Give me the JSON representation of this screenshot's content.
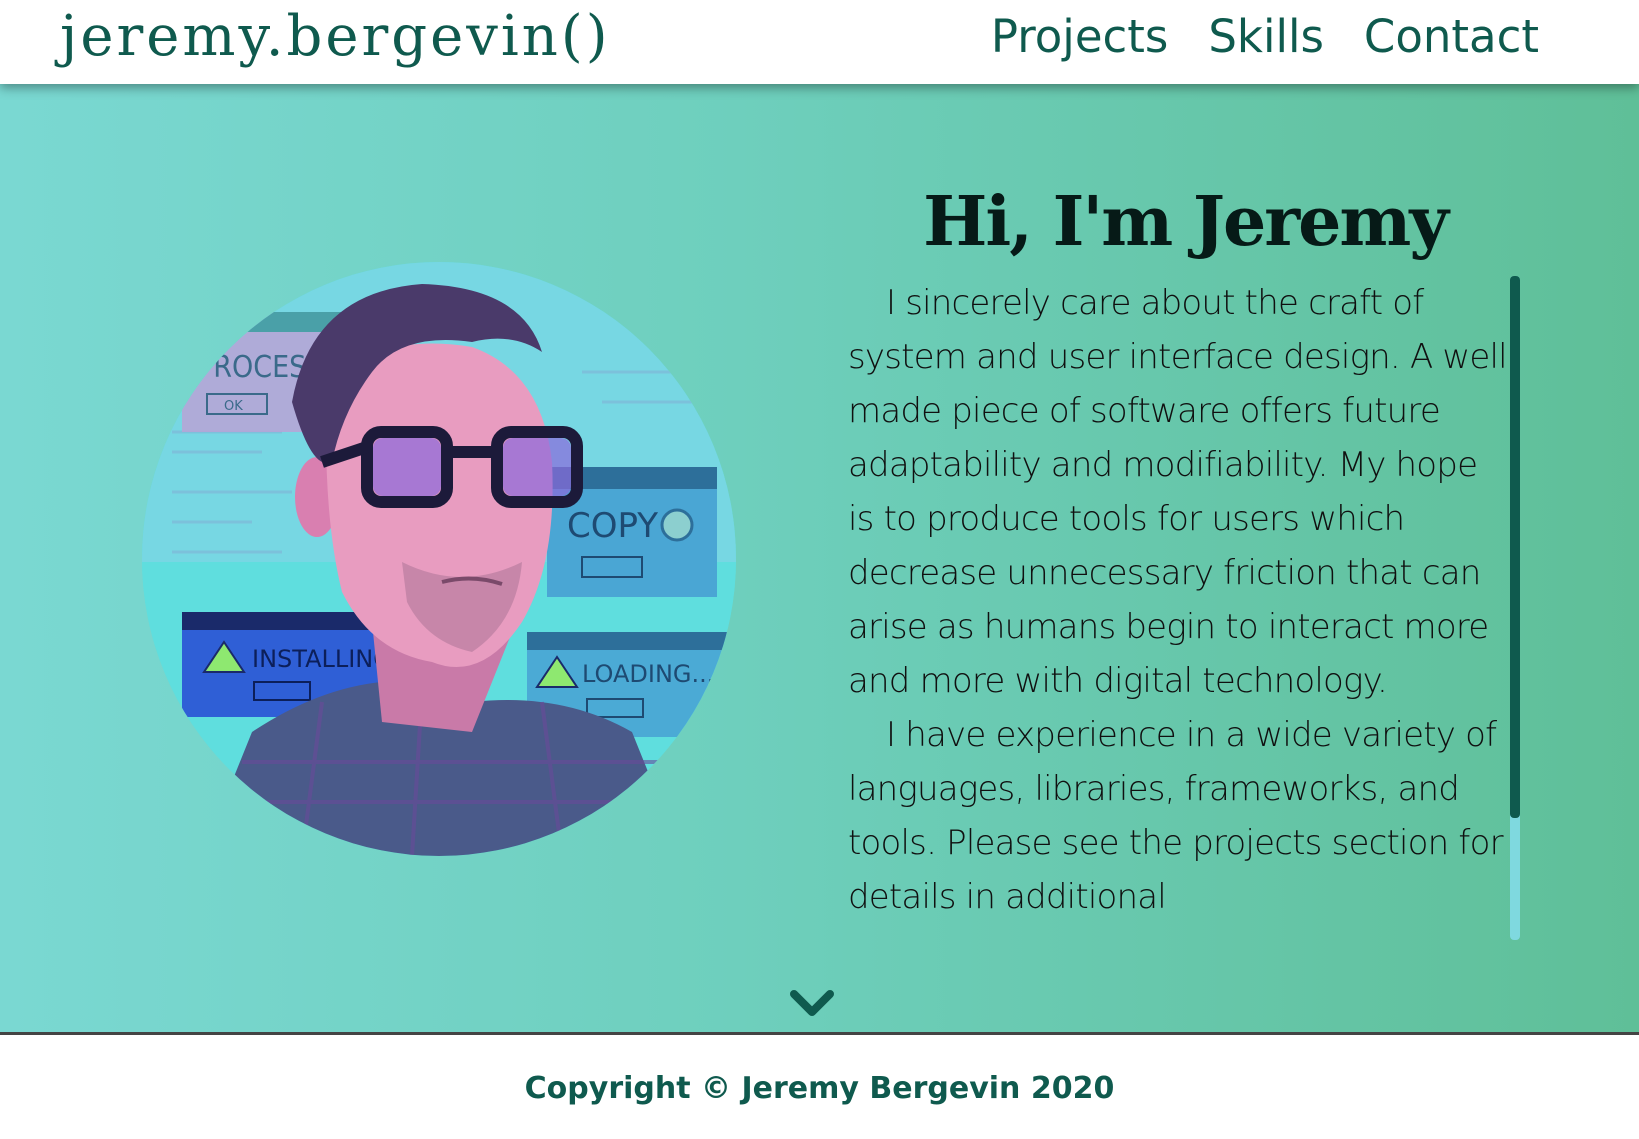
{
  "header": {
    "logo": "jeremy.bergevin()",
    "nav": [
      {
        "label": "Projects"
      },
      {
        "label": "Skills"
      },
      {
        "label": "Contact"
      }
    ]
  },
  "hero": {
    "greeting": "Hi, I'm Jeremy",
    "paragraphs": [
      "I sincerely care about the craft of system and user interface design. A well made piece of software offers future adaptability and modifiability. My hope is to produce tools for users which decrease unnecessary friction that can arise as humans begin to interact more and more with digital technology.",
      "I have experience in a wide variety of languages, libraries, frameworks, and tools. Please see the projects section for details in additional"
    ],
    "portrait_popups": {
      "processing": "PROCESSING...",
      "copy": "COPY",
      "installing": "INSTALLING",
      "loading": "LOADING...",
      "ok": "OK"
    },
    "scroll_down_icon": "chevron-down-icon"
  },
  "footer": {
    "copyright": "Copyright © Jeremy Bergevin 2020"
  },
  "colors": {
    "brand": "#0f5a4e",
    "hero_left": "#7ad8d2",
    "hero_right": "#5fbf98"
  }
}
